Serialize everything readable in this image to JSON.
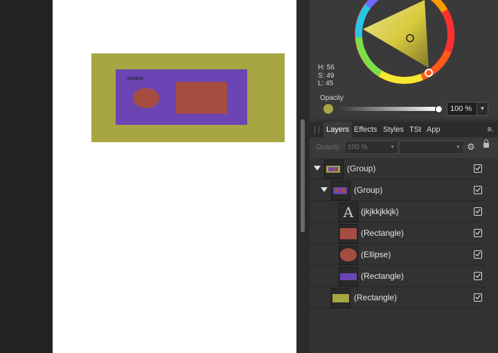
{
  "canvas": {
    "artwork_text": "jkjkkjkkjk",
    "colors": {
      "background": "#a8a642",
      "group_rect": "#6a45b3",
      "shapes": "#a54d40"
    }
  },
  "color_panel": {
    "h": "H: 56",
    "s": "S: 49",
    "l": "L: 45",
    "opacity_label": "Opacity",
    "opacity_value": "100 %",
    "opacity_level": 1.0,
    "current_color": "#a8a642"
  },
  "tabs": [
    {
      "label": "Layers",
      "active": true
    },
    {
      "label": "Effects",
      "active": false
    },
    {
      "label": "Styles",
      "active": false
    },
    {
      "label": "TSt",
      "active": false
    },
    {
      "label": "App",
      "active": false
    }
  ],
  "tab_menu_icon": "≡.",
  "layer_toolbar": {
    "opacity_label": "Opacity:",
    "opacity_value": "100 %",
    "blend_mode": "",
    "gear_icon": "gear-icon",
    "lock_icon": "lock-icon"
  },
  "layers": [
    {
      "name": "(Group)",
      "depth": 0,
      "expanded": true,
      "thumb": "group-outer",
      "visible": true
    },
    {
      "name": "(Group)",
      "depth": 1,
      "expanded": true,
      "thumb": "group-inner",
      "visible": true
    },
    {
      "name": "(jkjkkjkkjk)",
      "depth": 2,
      "thumb": "text",
      "thumb_glyph": "A",
      "visible": true
    },
    {
      "name": "(Rectangle)",
      "depth": 2,
      "thumb": "rect-red",
      "visible": true
    },
    {
      "name": "(Ellipse)",
      "depth": 2,
      "thumb": "ellipse-red",
      "visible": true
    },
    {
      "name": "(Rectangle)",
      "depth": 2,
      "thumb": "rect-purple",
      "visible": true
    },
    {
      "name": "(Rectangle)",
      "depth": 1,
      "thumb": "rect-yellow",
      "visible": true
    }
  ]
}
